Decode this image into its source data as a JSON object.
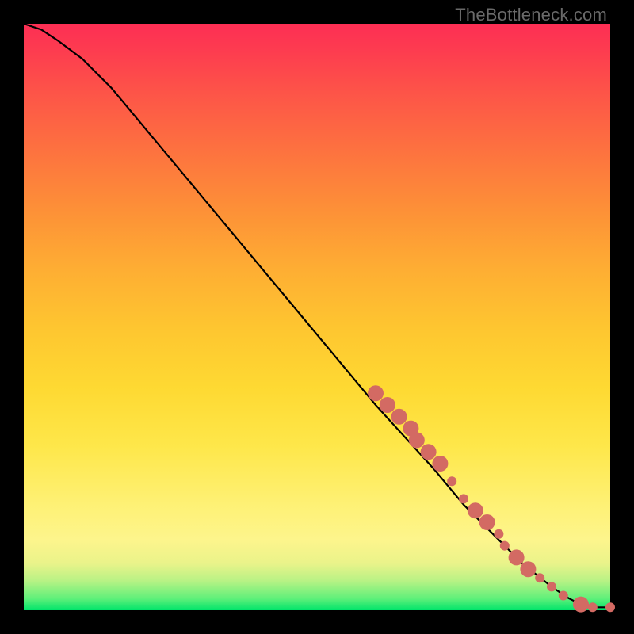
{
  "watermark": "TheBottleneck.com",
  "chart_data": {
    "type": "line",
    "title": "",
    "xlabel": "",
    "ylabel": "",
    "xlim": [
      0,
      100
    ],
    "ylim": [
      0,
      100
    ],
    "axes_visible": false,
    "grid": false,
    "background": "red-yellow-green vertical gradient (green = low y)",
    "series": [
      {
        "name": "curve",
        "color": "#000000",
        "x": [
          0,
          3,
          6,
          10,
          15,
          20,
          30,
          40,
          50,
          60,
          70,
          75,
          80,
          85,
          90,
          93,
          95,
          97,
          100
        ],
        "y": [
          100,
          99,
          97,
          94,
          89,
          83,
          71,
          59,
          47,
          35,
          24,
          18,
          13,
          8,
          4,
          2,
          1,
          0.5,
          0.5
        ]
      }
    ],
    "markers": {
      "name": "highlighted-points",
      "color": "#d36a63",
      "radius_small": 6,
      "radius_large": 10,
      "points": [
        {
          "x": 60,
          "y": 37,
          "r": 10
        },
        {
          "x": 62,
          "y": 35,
          "r": 10
        },
        {
          "x": 64,
          "y": 33,
          "r": 10
        },
        {
          "x": 66,
          "y": 31,
          "r": 10
        },
        {
          "x": 67,
          "y": 29,
          "r": 10
        },
        {
          "x": 69,
          "y": 27,
          "r": 10
        },
        {
          "x": 71,
          "y": 25,
          "r": 10
        },
        {
          "x": 73,
          "y": 22,
          "r": 6
        },
        {
          "x": 75,
          "y": 19,
          "r": 6
        },
        {
          "x": 77,
          "y": 17,
          "r": 10
        },
        {
          "x": 79,
          "y": 15,
          "r": 10
        },
        {
          "x": 81,
          "y": 13,
          "r": 6
        },
        {
          "x": 82,
          "y": 11,
          "r": 6
        },
        {
          "x": 84,
          "y": 9,
          "r": 10
        },
        {
          "x": 86,
          "y": 7,
          "r": 10
        },
        {
          "x": 88,
          "y": 5.5,
          "r": 6
        },
        {
          "x": 90,
          "y": 4,
          "r": 6
        },
        {
          "x": 92,
          "y": 2.5,
          "r": 6
        },
        {
          "x": 95,
          "y": 1,
          "r": 10
        },
        {
          "x": 97,
          "y": 0.5,
          "r": 6
        },
        {
          "x": 100,
          "y": 0.5,
          "r": 6
        }
      ]
    }
  }
}
